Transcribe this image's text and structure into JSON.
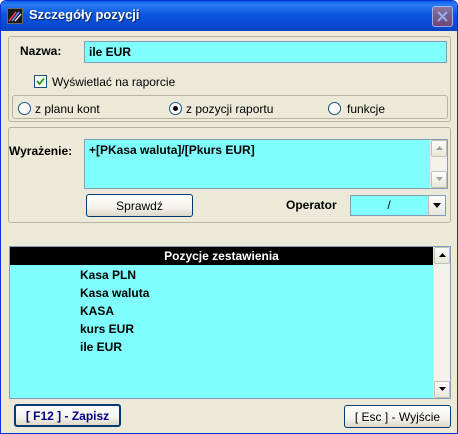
{
  "window": {
    "title": "Szczegóły pozycji"
  },
  "name_field": {
    "label": "Nazwa:",
    "value": "ile EUR"
  },
  "show_in_report": {
    "label": "Wyświetlać na raporcie",
    "checked": true
  },
  "source": {
    "options": [
      "z planu kont",
      "z pozycji raportu",
      "funkcje"
    ],
    "selected": "z pozycji raportu"
  },
  "expression": {
    "label": "Wyrażenie:",
    "value": "+[PKasa waluta]/[Pkurs EUR]"
  },
  "check_button": {
    "label": "Sprawdź"
  },
  "operator": {
    "label": "Operator",
    "value": "/"
  },
  "positions_list": {
    "header": "Pozycje zestawienia",
    "items": [
      "Kasa PLN",
      "Kasa waluta",
      "KASA",
      "kurs EUR",
      "ile EUR"
    ]
  },
  "footer": {
    "save_label": "[ F12 ] - Zapisz",
    "exit_label": "[ Esc ] - Wyjście"
  },
  "colors": {
    "titlebar": "#0a55de",
    "field_background": "#80ffff",
    "window_background": "#ece9d8",
    "save_text": "#00008b"
  },
  "icons": [
    "app-icon",
    "close-icon",
    "checkmark-icon",
    "scroll-up-arrow-icon",
    "scroll-down-arrow-icon",
    "dropdown-arrow-icon"
  ]
}
